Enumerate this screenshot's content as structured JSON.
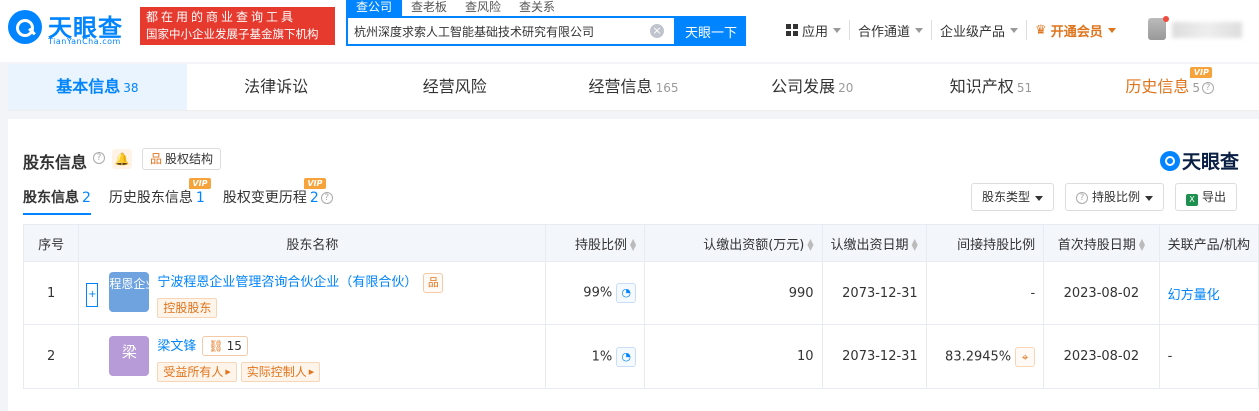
{
  "header": {
    "brand": "天眼查",
    "domain": "TianYanCha.com",
    "promo_line1": "都在用的商业查询工具",
    "promo_line2": "国家中小企业发展子基金旗下机构",
    "search_tabs": [
      "查公司",
      "查老板",
      "查风险",
      "查关系"
    ],
    "search_value": "杭州深度求索人工智能基础技术研究有限公司",
    "search_button": "天眼一下",
    "nav": {
      "apps": "应用",
      "channel": "合作通道",
      "enterprise": "企业级产品",
      "vip": "开通会员"
    }
  },
  "module_tabs": [
    {
      "label": "基本信息",
      "count": "38"
    },
    {
      "label": "法律诉讼",
      "count": ""
    },
    {
      "label": "经营风险",
      "count": ""
    },
    {
      "label": "经营信息",
      "count": "165"
    },
    {
      "label": "公司发展",
      "count": "20"
    },
    {
      "label": "知识产权",
      "count": "51"
    },
    {
      "label": "历史信息",
      "count": "5"
    }
  ],
  "vip_badge": "VIP",
  "section": {
    "title": "股东信息",
    "structure_button": "股权结构",
    "watermark": "天眼查",
    "sub_tabs": [
      {
        "label": "股东信息",
        "count": "2"
      },
      {
        "label": "历史股东信息",
        "count": "1"
      },
      {
        "label": "股权变更历程",
        "count": "2"
      }
    ],
    "tools": {
      "type": "股东类型",
      "ratio": "持股比例",
      "export": "导出"
    }
  },
  "table": {
    "headers": [
      "序号",
      "股东名称",
      "持股比例",
      "认缴出资额(万元)",
      "认缴出资日期",
      "间接持股比例",
      "首次持股日期",
      "关联产品/机构"
    ],
    "rows": [
      {
        "idx": "1",
        "avatar": "程恩企业",
        "name": "宁波程恩企业管理咨询合伙企业（有限合伙）",
        "tags": [
          "控股股东"
        ],
        "ratio": "99%",
        "capital": "990",
        "date": "2073-12-31",
        "indirect": "-",
        "first": "2023-08-02",
        "related": "幻方量化"
      },
      {
        "idx": "2",
        "avatar": "梁",
        "name": "梁文锋",
        "count": "15",
        "tags": [
          "受益所有人",
          "实际控制人"
        ],
        "ratio": "1%",
        "capital": "10",
        "date": "2073-12-31",
        "indirect": "83.2945%",
        "first": "2023-08-02",
        "related": "-"
      }
    ]
  },
  "colors": {
    "primary": "#0084ff",
    "promo_red": "#e73a2f",
    "vip_orange": "#e0741c"
  }
}
